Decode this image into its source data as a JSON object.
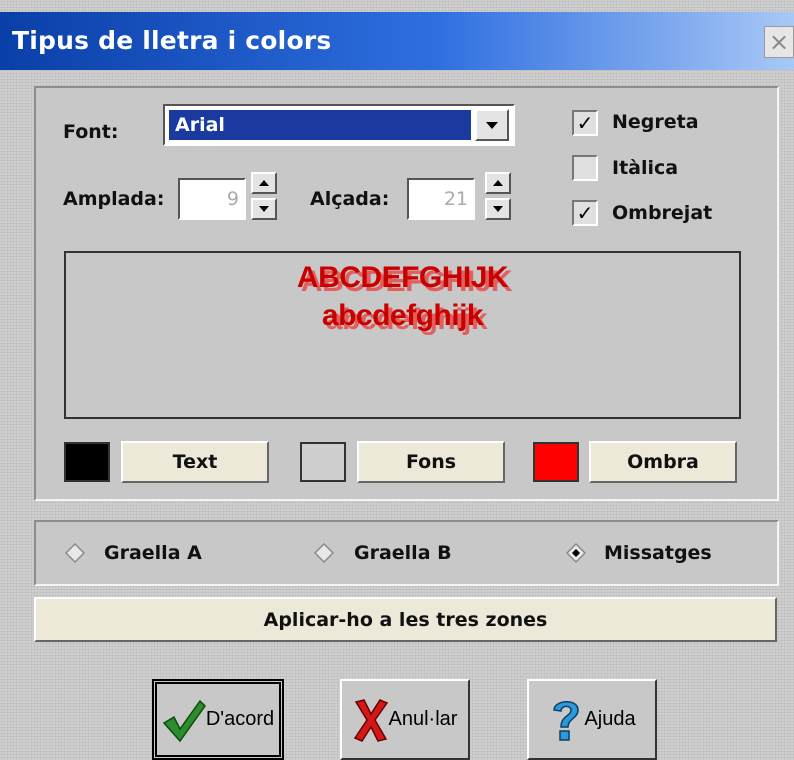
{
  "window": {
    "title": "Tipus de lletra i colors",
    "close_glyph": "×"
  },
  "font_section": {
    "font_label": "Font:",
    "font_value": "Arial",
    "width_label": "Amplada:",
    "width_value": "9",
    "height_label": "Alçada:",
    "height_value": "21",
    "checkboxes": [
      {
        "label": "Negreta",
        "checked": true,
        "mark": "✓"
      },
      {
        "label": "Itàlica",
        "checked": false,
        "mark": ""
      },
      {
        "label": "Ombrejat",
        "checked": true,
        "mark": "✓"
      }
    ]
  },
  "preview": {
    "line1": "ABCDEFGHIJK",
    "line2": "abcdefghijk",
    "text_color": "#c80000",
    "shadow_color": "#e06060"
  },
  "colors": [
    {
      "label": "Text",
      "swatch": "#000000"
    },
    {
      "label": "Fons",
      "swatch": "#cfcfcf"
    },
    {
      "label": "Ombra",
      "swatch": "#ff0000"
    }
  ],
  "zones": {
    "options": [
      {
        "label": "Graella A",
        "selected": false
      },
      {
        "label": "Graella B",
        "selected": false
      },
      {
        "label": "Missatges",
        "selected": true
      }
    ],
    "apply_label": "Aplicar-ho a les tres zones"
  },
  "actions": {
    "ok_label": "D'acord",
    "cancel_label": "Anul·lar",
    "help_label": "Ajuda",
    "icons": [
      "check-icon",
      "x-icon",
      "question-icon"
    ]
  }
}
